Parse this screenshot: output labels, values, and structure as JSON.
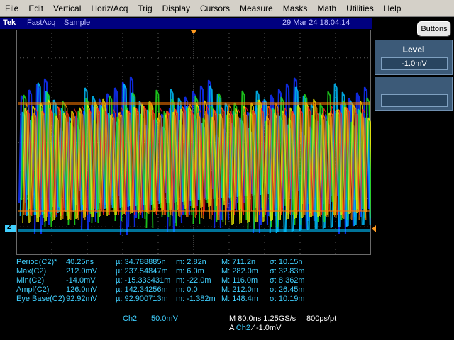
{
  "menu": [
    "File",
    "Edit",
    "Vertical",
    "Horiz/Acq",
    "Trig",
    "Display",
    "Cursors",
    "Measure",
    "Masks",
    "Math",
    "Utilities",
    "Help"
  ],
  "status": {
    "brand": "Tek",
    "mode": "FastAcq",
    "acquisition": "Sample",
    "datetime": "29 Mar 24 18:04:14"
  },
  "buttons_label": "Buttons",
  "side_panel": {
    "title": "Level",
    "value": "-1.0mV"
  },
  "channel_marker": "2",
  "measurements": [
    {
      "name": "Period(C2)*",
      "value": "40.25ns",
      "mean": "µ: 34.788885n",
      "min": "m: 2.82n",
      "max": "M: 711.2n",
      "sigma": "σ: 10.15n"
    },
    {
      "name": "Max(C2)",
      "value": "212.0mV",
      "mean": "µ: 237.54847m",
      "min": "m: 6.0m",
      "max": "M: 282.0m",
      "sigma": "σ: 32.83m"
    },
    {
      "name": "Min(C2)",
      "value": "-14.0mV",
      "mean": "µ: -15.333431m",
      "min": "m: -22.0m",
      "max": "M: 116.0m",
      "sigma": "σ: 8.362m"
    },
    {
      "name": "Ampl(C2)",
      "value": "126.0mV",
      "mean": "µ: 142.34256m",
      "min": "m: 0.0",
      "max": "M: 212.0m",
      "sigma": "σ: 26.45m"
    },
    {
      "name": "Eye Base(C2)",
      "value": "92.92mV",
      "mean": "µ: 92.900713m",
      "min": "m: -1.382m",
      "max": "M: 148.4m",
      "sigma": "σ: 10.19m"
    }
  ],
  "bottom": {
    "channel": "Ch2",
    "scale": "50.0mV",
    "timebase": "M 80.0ns 1.25GS/s",
    "resolution": "800ps/pt",
    "trigger_prefix": "A",
    "trigger_channel": "Ch2",
    "trigger_slope": "⁄",
    "trigger_level": "-1.0mV"
  },
  "colors": {
    "background": "#000000",
    "menu_bg": "#d4d0c8",
    "status_bg": "#000080",
    "readout": "#40d0ff",
    "panel": "#3c5a78"
  }
}
